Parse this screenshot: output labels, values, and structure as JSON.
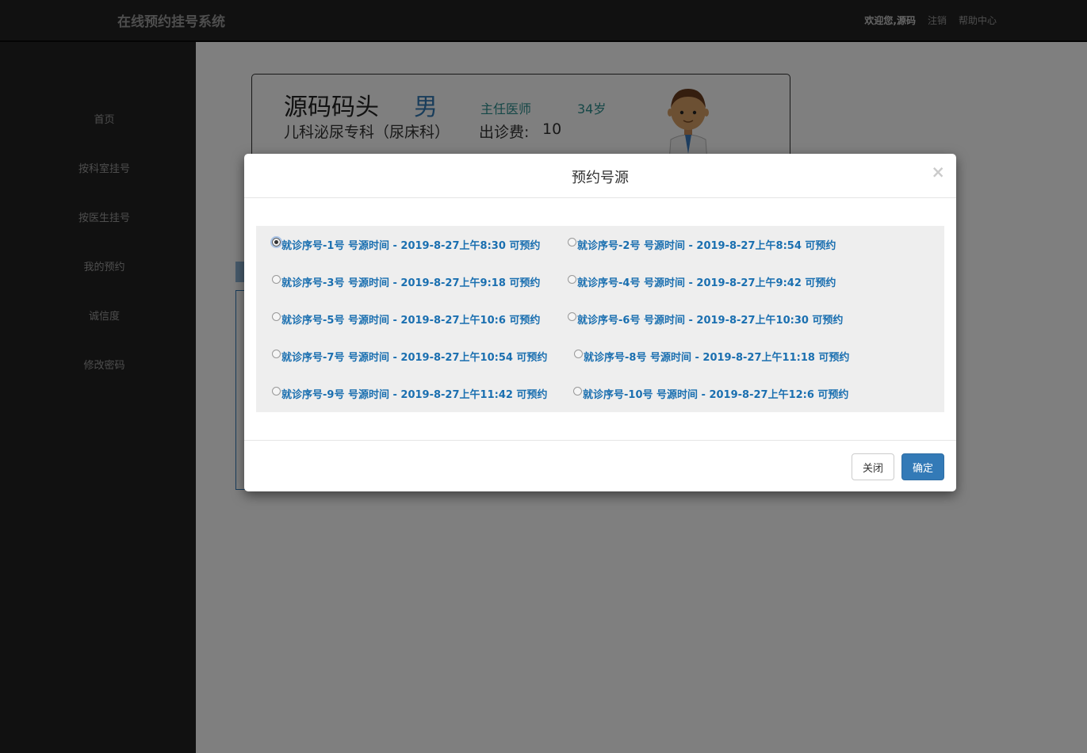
{
  "header": {
    "brand": "在线预约挂号系统",
    "welcome": "欢迎您,源码",
    "logout": "注销",
    "help": "帮助中心"
  },
  "sidebar": {
    "items": [
      {
        "label": "首页"
      },
      {
        "label": "按科室挂号"
      },
      {
        "label": "按医生挂号"
      },
      {
        "label": "我的预约"
      },
      {
        "label": "诚信度"
      },
      {
        "label": "修改密码"
      }
    ]
  },
  "doctor": {
    "name": "源码码头",
    "sex": "男",
    "title": "主任医师",
    "age": "34岁",
    "department": "儿科泌尿专科（尿床科）",
    "fee_label": "出诊费:",
    "fee": "10"
  },
  "modal": {
    "title": "预约号源",
    "close_icon": "×",
    "slots": [
      {
        "label": "就诊序号-1号 号源时间 - 2019-8-27上午8:30 可预约",
        "checked": true
      },
      {
        "label": "就诊序号-2号 号源时间 - 2019-8-27上午8:54 可预约",
        "checked": false
      },
      {
        "label": "就诊序号-3号 号源时间 - 2019-8-27上午9:18 可预约",
        "checked": false
      },
      {
        "label": "就诊序号-4号 号源时间 - 2019-8-27上午9:42 可预约",
        "checked": false
      },
      {
        "label": "就诊序号-5号 号源时间 - 2019-8-27上午10:6 可预约",
        "checked": false
      },
      {
        "label": "就诊序号-6号 号源时间 - 2019-8-27上午10:30 可预约",
        "checked": false
      },
      {
        "label": "就诊序号-7号 号源时间 - 2019-8-27上午10:54 可预约",
        "checked": false
      },
      {
        "label": "就诊序号-8号 号源时间 - 2019-8-27上午11:18 可预约",
        "checked": false
      },
      {
        "label": "就诊序号-9号 号源时间 - 2019-8-27上午11:42 可预约",
        "checked": false
      },
      {
        "label": "就诊序号-10号 号源时间 - 2019-8-27上午12:6 可预约",
        "checked": false
      }
    ],
    "close_button": "关闭",
    "confirm_button": "确定"
  },
  "colors": {
    "topbar": "#222222",
    "primary": "#337ab7",
    "slot_text": "#1a6fb0"
  }
}
